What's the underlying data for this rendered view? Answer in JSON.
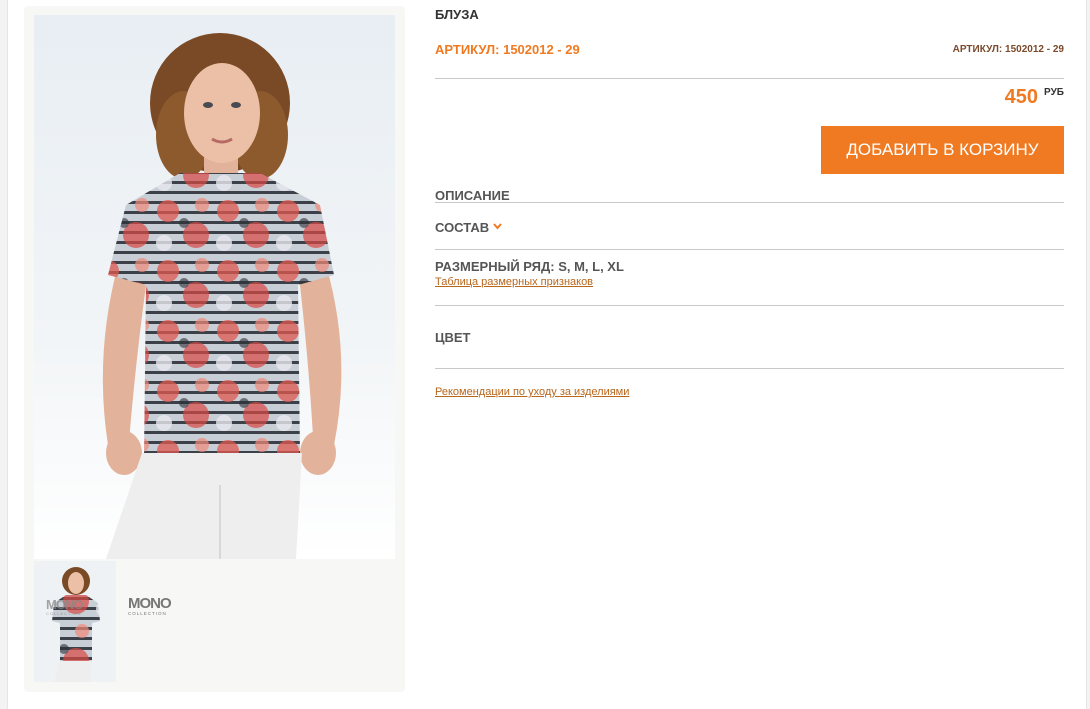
{
  "product": {
    "title": "БЛУЗА",
    "sku_label": "АРТИКУЛ: 1502012 - 29",
    "sku_label_small": "АРТИКУЛ: 1502012 - 29",
    "price": "450",
    "currency": "РУБ",
    "add_to_cart_label": "ДОБАВИТЬ В КОРЗИНУ"
  },
  "sections": {
    "description_label": "ОПИСАНИЕ",
    "composition_label": "СОСТАВ",
    "size_range_label": "РАЗМЕРНЫЙ РЯД: S, M, L, XL",
    "size_table_link": "Таблица размерных признаков",
    "color_label": "ЦВЕТ",
    "care_link": "Рекомендации по уходу за изделиями"
  },
  "gallery": {
    "brand_logo": "MONO",
    "brand_logo_sub": "COLLECTION"
  },
  "colors": {
    "accent": "#f07a22",
    "link": "#b8661c"
  },
  "icons": {
    "composition_toggle": "chevron-down-icon"
  }
}
